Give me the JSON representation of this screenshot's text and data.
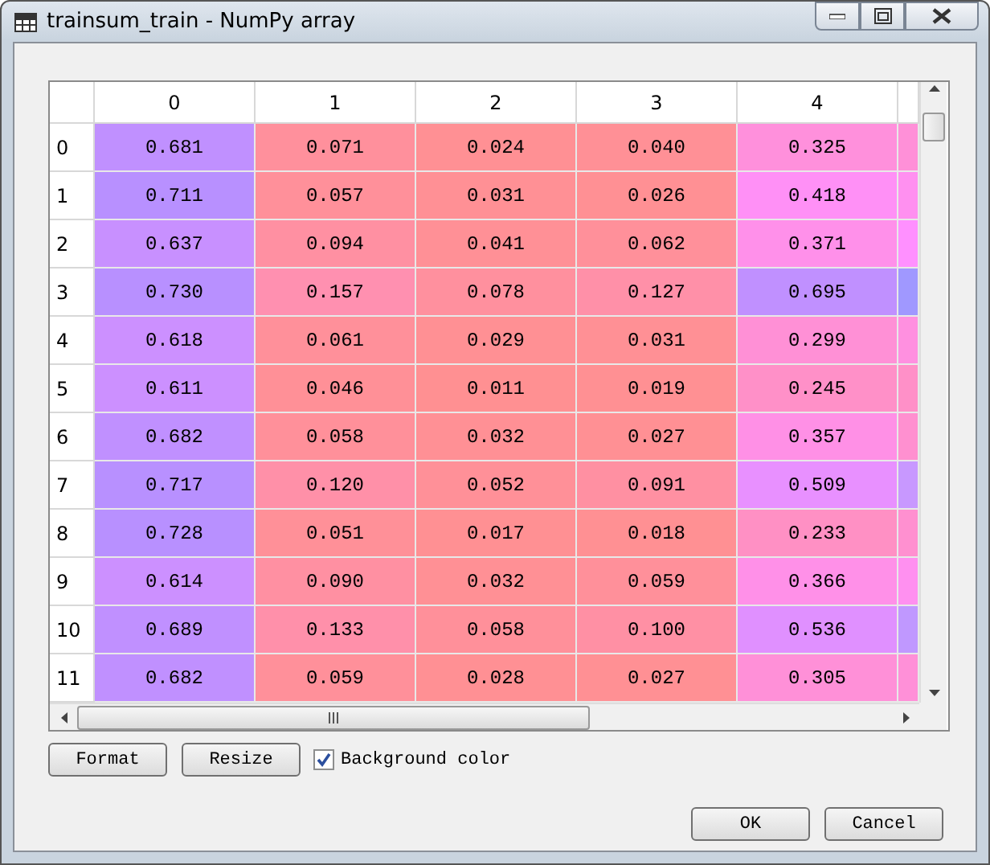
{
  "window": {
    "title": "trainsum_train - NumPy array"
  },
  "table": {
    "columns": [
      "0",
      "1",
      "2",
      "3",
      "4"
    ],
    "rows": [
      {
        "label": "0",
        "cells": [
          {
            "value": "0.681",
            "color": "#c090ff"
          },
          {
            "value": "0.071",
            "color": "#ff909c"
          },
          {
            "value": "0.024",
            "color": "#ff9094"
          },
          {
            "value": "0.040",
            "color": "#ff9096"
          },
          {
            "value": "0.325",
            "color": "#ff90dc"
          },
          {
            "color": "#ff90d8"
          }
        ]
      },
      {
        "label": "1",
        "cells": [
          {
            "value": "0.711",
            "color": "#b890ff"
          },
          {
            "value": "0.057",
            "color": "#ff909a"
          },
          {
            "value": "0.031",
            "color": "#ff9095"
          },
          {
            "value": "0.026",
            "color": "#ff9094"
          },
          {
            "value": "0.418",
            "color": "#ff90f6"
          },
          {
            "color": "#ff90f0"
          }
        ]
      },
      {
        "label": "2",
        "cells": [
          {
            "value": "0.637",
            "color": "#c890ff"
          },
          {
            "value": "0.094",
            "color": "#ff90a2"
          },
          {
            "value": "0.041",
            "color": "#ff9096"
          },
          {
            "value": "0.062",
            "color": "#ff909a"
          },
          {
            "value": "0.371",
            "color": "#ff90ea"
          },
          {
            "color": "#ff90ff"
          }
        ]
      },
      {
        "label": "3",
        "cells": [
          {
            "value": "0.730",
            "color": "#b890ff"
          },
          {
            "value": "0.157",
            "color": "#ff90b0"
          },
          {
            "value": "0.078",
            "color": "#ff909e"
          },
          {
            "value": "0.127",
            "color": "#ff90a8"
          },
          {
            "value": "0.695",
            "color": "#c090ff"
          },
          {
            "color": "#a098ff"
          }
        ]
      },
      {
        "label": "4",
        "cells": [
          {
            "value": "0.618",
            "color": "#cc90ff"
          },
          {
            "value": "0.061",
            "color": "#ff909a"
          },
          {
            "value": "0.029",
            "color": "#ff9094"
          },
          {
            "value": "0.031",
            "color": "#ff9095"
          },
          {
            "value": "0.299",
            "color": "#ff90d6"
          },
          {
            "color": "#ff90e0"
          }
        ]
      },
      {
        "label": "5",
        "cells": [
          {
            "value": "0.611",
            "color": "#cc90ff"
          },
          {
            "value": "0.046",
            "color": "#ff9097"
          },
          {
            "value": "0.011",
            "color": "#ff9092"
          },
          {
            "value": "0.019",
            "color": "#ff9093"
          },
          {
            "value": "0.245",
            "color": "#ff90c8"
          },
          {
            "color": "#ff90c8"
          }
        ]
      },
      {
        "label": "6",
        "cells": [
          {
            "value": "0.682",
            "color": "#c090ff"
          },
          {
            "value": "0.058",
            "color": "#ff909a"
          },
          {
            "value": "0.032",
            "color": "#ff9095"
          },
          {
            "value": "0.027",
            "color": "#ff9094"
          },
          {
            "value": "0.357",
            "color": "#ff90e6"
          },
          {
            "color": "#ff90d0"
          }
        ]
      },
      {
        "label": "7",
        "cells": [
          {
            "value": "0.717",
            "color": "#b890ff"
          },
          {
            "value": "0.120",
            "color": "#ff90a8"
          },
          {
            "value": "0.052",
            "color": "#ff9098"
          },
          {
            "value": "0.091",
            "color": "#ff90a2"
          },
          {
            "value": "0.509",
            "color": "#e890ff"
          },
          {
            "color": "#c898ff"
          }
        ]
      },
      {
        "label": "8",
        "cells": [
          {
            "value": "0.728",
            "color": "#b890ff"
          },
          {
            "value": "0.051",
            "color": "#ff9098"
          },
          {
            "value": "0.017",
            "color": "#ff9093"
          },
          {
            "value": "0.018",
            "color": "#ff9093"
          },
          {
            "value": "0.233",
            "color": "#ff90c4"
          },
          {
            "color": "#ff90d0"
          }
        ]
      },
      {
        "label": "9",
        "cells": [
          {
            "value": "0.614",
            "color": "#cc90ff"
          },
          {
            "value": "0.090",
            "color": "#ff90a2"
          },
          {
            "value": "0.032",
            "color": "#ff9095"
          },
          {
            "value": "0.059",
            "color": "#ff909a"
          },
          {
            "value": "0.366",
            "color": "#ff90e8"
          },
          {
            "color": "#ff90f0"
          }
        ]
      },
      {
        "label": "10",
        "cells": [
          {
            "value": "0.689",
            "color": "#c090ff"
          },
          {
            "value": "0.133",
            "color": "#ff90aa"
          },
          {
            "value": "0.058",
            "color": "#ff909a"
          },
          {
            "value": "0.100",
            "color": "#ff90a4"
          },
          {
            "value": "0.536",
            "color": "#e090ff"
          },
          {
            "color": "#c098ff"
          }
        ]
      },
      {
        "label": "11",
        "cells": [
          {
            "value": "0.682",
            "color": "#c090ff"
          },
          {
            "value": "0.059",
            "color": "#ff909a"
          },
          {
            "value": "0.028",
            "color": "#ff9094"
          },
          {
            "value": "0.027",
            "color": "#ff9094"
          },
          {
            "value": "0.305",
            "color": "#ff90d8"
          },
          {
            "color": "#ff90d8"
          }
        ]
      }
    ]
  },
  "buttons": [
    {
      "label": "Format"
    },
    {
      "label": "Resize"
    }
  ],
  "background_color": {
    "label": "Background color",
    "checked": true
  },
  "dialog_buttons": [
    {
      "label": "OK"
    },
    {
      "label": "Cancel"
    }
  ]
}
